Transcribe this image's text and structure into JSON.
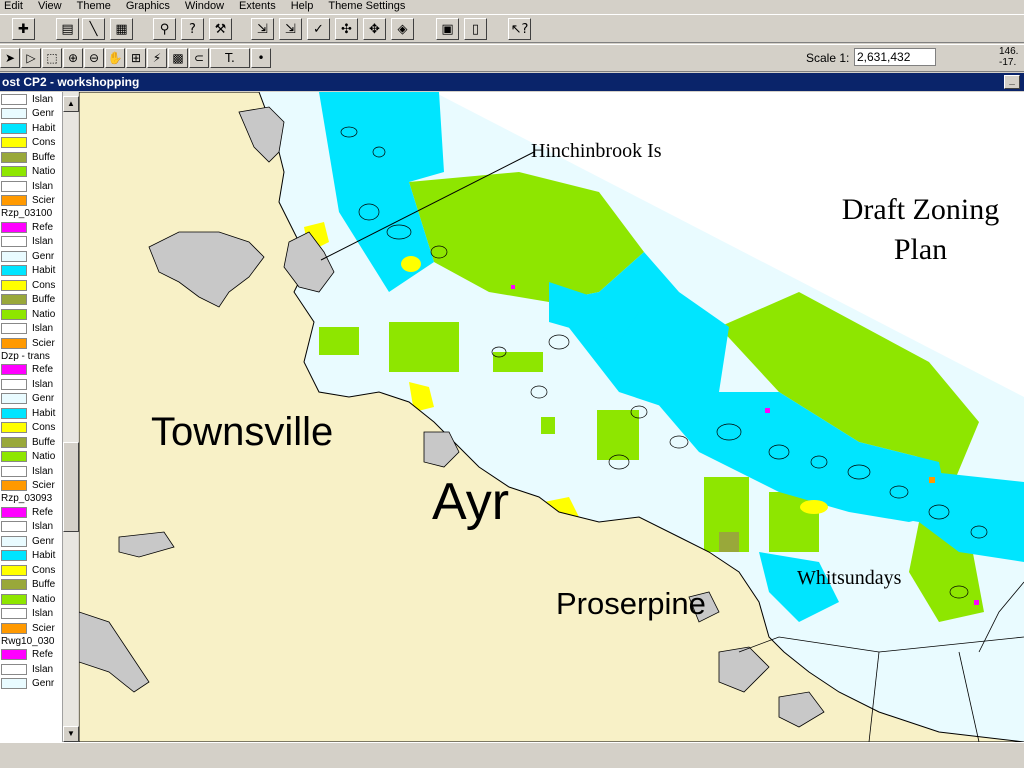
{
  "menu": [
    "Edit",
    "View",
    "Theme",
    "Graphics",
    "Window",
    "Extents",
    "Help",
    "Theme Settings"
  ],
  "toolbar2": {
    "scale_label": "Scale 1:",
    "scale_value": "2,631,432",
    "coord_x": "146.",
    "coord_y": "-17."
  },
  "view": {
    "title": "ost CP2 - workshopping",
    "minimize": "_"
  },
  "colors": {
    "reference": "#ff00ff",
    "island": "#ffffff",
    "general": "#e9fbff",
    "habitat": "#00e5ff",
    "conservation": "#ffff00",
    "buffer": "#99a83a",
    "national_park": "#8ee600",
    "scientific": "#ff9900",
    "land": "#f8f1c7",
    "land_islands": "#c8c8c8"
  },
  "legend": {
    "first_rows": [
      {
        "label": "Islan",
        "color": "#ffffff"
      },
      {
        "label": "Genr",
        "color": "#e9fbff"
      },
      {
        "label": "Habit",
        "color": "#00e5ff"
      },
      {
        "label": "Cons",
        "color": "#ffff00"
      },
      {
        "label": "Buffe",
        "color": "#99a83a"
      },
      {
        "label": "Natio",
        "color": "#8ee600"
      },
      {
        "label": "Islan",
        "color": "#ffffff"
      },
      {
        "label": "Scier",
        "color": "#ff9900"
      }
    ],
    "groups": [
      {
        "title": "Rzp_03100",
        "rows": [
          {
            "label": "Refe",
            "color": "#ff00ff"
          },
          {
            "label": "Islan",
            "color": "#ffffff"
          },
          {
            "label": "Genr",
            "color": "#e9fbff"
          },
          {
            "label": "Habit",
            "color": "#00e5ff"
          },
          {
            "label": "Cons",
            "color": "#ffff00"
          },
          {
            "label": "Buffe",
            "color": "#99a83a"
          },
          {
            "label": "Natio",
            "color": "#8ee600"
          },
          {
            "label": "Islan",
            "color": "#ffffff"
          },
          {
            "label": "Scier",
            "color": "#ff9900"
          }
        ]
      },
      {
        "title": "Dzp - trans",
        "rows": [
          {
            "label": "Refe",
            "color": "#ff00ff"
          },
          {
            "label": "Islan",
            "color": "#ffffff"
          },
          {
            "label": "Genr",
            "color": "#e9fbff"
          },
          {
            "label": "Habit",
            "color": "#00e5ff"
          },
          {
            "label": "Cons",
            "color": "#ffff00"
          },
          {
            "label": "Buffe",
            "color": "#99a83a"
          },
          {
            "label": "Natio",
            "color": "#8ee600"
          },
          {
            "label": "Islan",
            "color": "#ffffff"
          },
          {
            "label": "Scier",
            "color": "#ff9900"
          }
        ]
      },
      {
        "title": "Rzp_03093",
        "rows": [
          {
            "label": "Refe",
            "color": "#ff00ff"
          },
          {
            "label": "Islan",
            "color": "#ffffff"
          },
          {
            "label": "Genr",
            "color": "#e9fbff"
          },
          {
            "label": "Habit",
            "color": "#00e5ff"
          },
          {
            "label": "Cons",
            "color": "#ffff00"
          },
          {
            "label": "Buffe",
            "color": "#99a83a"
          },
          {
            "label": "Natio",
            "color": "#8ee600"
          },
          {
            "label": "Islan",
            "color": "#ffffff"
          },
          {
            "label": "Scier",
            "color": "#ff9900"
          }
        ]
      },
      {
        "title": "Rwg10_030",
        "rows": [
          {
            "label": "Refe",
            "color": "#ff00ff"
          },
          {
            "label": "Islan",
            "color": "#ffffff"
          },
          {
            "label": "Genr",
            "color": "#e9fbff"
          }
        ]
      }
    ]
  },
  "map_labels": {
    "townsville": "Townsville",
    "ayr": "Ayr",
    "proserpine": "Proserpine",
    "hinchinbrook": "Hinchinbrook Is",
    "whitsundays": "Whitsundays",
    "draft_line1": "Draft Zoning",
    "draft_line2": "Plan"
  },
  "icons": {
    "toolbar1": [
      "add-theme-icon",
      "theme-properties-icon",
      "edit-legend-icon",
      "open-table-icon",
      "find-icon",
      "identify-icon",
      "query-builder-icon",
      "zoom-full-icon",
      "zoom-active-icon",
      "zoom-selected-icon",
      "zoom-in-fixed-icon",
      "zoom-out-fixed-icon",
      "zoom-previous-icon",
      "select-features-icon",
      "layout-icon",
      "help-pointer-icon"
    ],
    "toolbar2": [
      "pointer-icon",
      "vertex-edit-icon",
      "select-box-icon",
      "zoom-in-icon",
      "zoom-out-icon",
      "pan-hand-icon",
      "measure-icon",
      "hotlink-icon",
      "area-select-icon",
      "label-icon",
      "text-tool-icon",
      "point-tool-icon"
    ]
  }
}
